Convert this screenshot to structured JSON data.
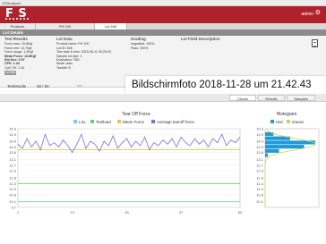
{
  "window": {
    "title": "EFAnalyzer"
  },
  "header": {
    "logo": "F S",
    "user": "admin",
    "settings_icon": "gear-icon"
  },
  "tabs": [
    {
      "label": "Products"
    },
    {
      "label": "PH 100"
    },
    {
      "label": "Lot 545",
      "active": true
    }
  ],
  "lot_bar": {
    "title": "Lot Details"
  },
  "details": {
    "test_results": {
      "heading": "Test Results",
      "lines": [
        "Force max: 15.8Kgf",
        "Force min: 14.7Kgf",
        "Force range: 1.4Kgf"
      ],
      "mean_force": "Mean Force: 13.8Kgf",
      "std_dev": "Std Dev: 0.57",
      "cpk": "CPK: 1.34",
      "cpk_ok": "CpK OK: 1.34",
      "tag": "Lot 545"
    },
    "lot_data": {
      "heading": "Lot Data",
      "lines": [
        "Product name: PH 100",
        "Lot ID: 545",
        "Test date & time: 2015-06-11 09:26:03",
        "Sample lot size: 1",
        "Evaluation: TBD",
        "Mode: auto",
        "Testdef: 8"
      ]
    },
    "grading": {
      "heading": "Grading",
      "lines": [
        "ungraded: 100%",
        "",
        "Pass: 100%"
      ]
    },
    "field_description": {
      "heading": "Lot Field Description"
    },
    "doc_icon": "document-icon"
  },
  "test_results_row": {
    "label": "Testresults",
    "count": "50 / 50"
  },
  "overlay_caption": "Bildschirmfoto 2018-11-28 um 21.42.43",
  "view_tabs": [
    {
      "label": "Charts",
      "active": true
    },
    {
      "label": "Results"
    },
    {
      "label": "Samples"
    }
  ],
  "chart_data": [
    {
      "type": "line",
      "title": "Tear Off Force",
      "series": [
        {
          "name": "LSL",
          "color": "#7ec8e3",
          "values": [
            10.1,
            10.1
          ]
        },
        {
          "name": "Testload",
          "color": "#6ccf6a",
          "values": [
            11.4,
            11.4
          ]
        },
        {
          "name": "Mean Force",
          "color": "#f2c24a",
          "values": [
            13.8,
            13.8
          ]
        },
        {
          "name": "Average tearoff force",
          "color": "#7a70e0",
          "values": [
            14.2,
            13.9,
            14.6,
            14.0,
            14.4,
            13.8,
            14.9,
            14.1,
            14.3,
            14.0,
            14.5,
            14.1,
            13.6,
            14.2,
            14.9,
            13.9,
            14.4,
            14.2,
            13.7,
            14.4,
            14.1,
            14.8,
            13.9,
            14.3,
            14.6,
            14.0,
            14.4,
            14.1,
            14.7,
            13.8,
            14.3,
            14.1,
            14.5,
            14.2,
            14.6,
            14.0,
            14.7,
            14.3,
            14.1,
            14.6,
            14.2,
            14.5,
            14.0,
            14.6,
            14.3,
            14.9,
            14.1,
            14.5,
            14.3,
            14.7
          ]
        }
      ],
      "x_ticks": [
        "1",
        "13",
        "25",
        "37",
        "50"
      ],
      "y_ticks": [
        "15.3",
        "14.9",
        "14.4",
        "14.0",
        "13.6",
        "13.1",
        "12.7",
        "12.3",
        "11.8",
        "11.4",
        "11.0",
        "10.6",
        "10.1",
        "9.7"
      ],
      "ylim": [
        9.7,
        15.3
      ]
    },
    {
      "type": "bar",
      "title": "Histogram",
      "series": [
        {
          "name": "Hist",
          "color": "#1e9ad6"
        },
        {
          "name": "Gauss",
          "color": "#c8d84a"
        }
      ],
      "y_ticks": [
        "15.3",
        "14.9",
        "14.4",
        "14.0",
        "13.6",
        "13.1",
        "12.7",
        "12.3",
        "11.8",
        "11.4",
        "11.0",
        "10.6",
        "10.1"
      ],
      "bins": [
        {
          "y": 14.9,
          "count": 3
        },
        {
          "y": 14.6,
          "count": 9
        },
        {
          "y": 14.3,
          "count": 18
        },
        {
          "y": 14.0,
          "count": 14
        },
        {
          "y": 13.7,
          "count": 5
        },
        {
          "y": 13.4,
          "count": 1
        }
      ]
    }
  ]
}
